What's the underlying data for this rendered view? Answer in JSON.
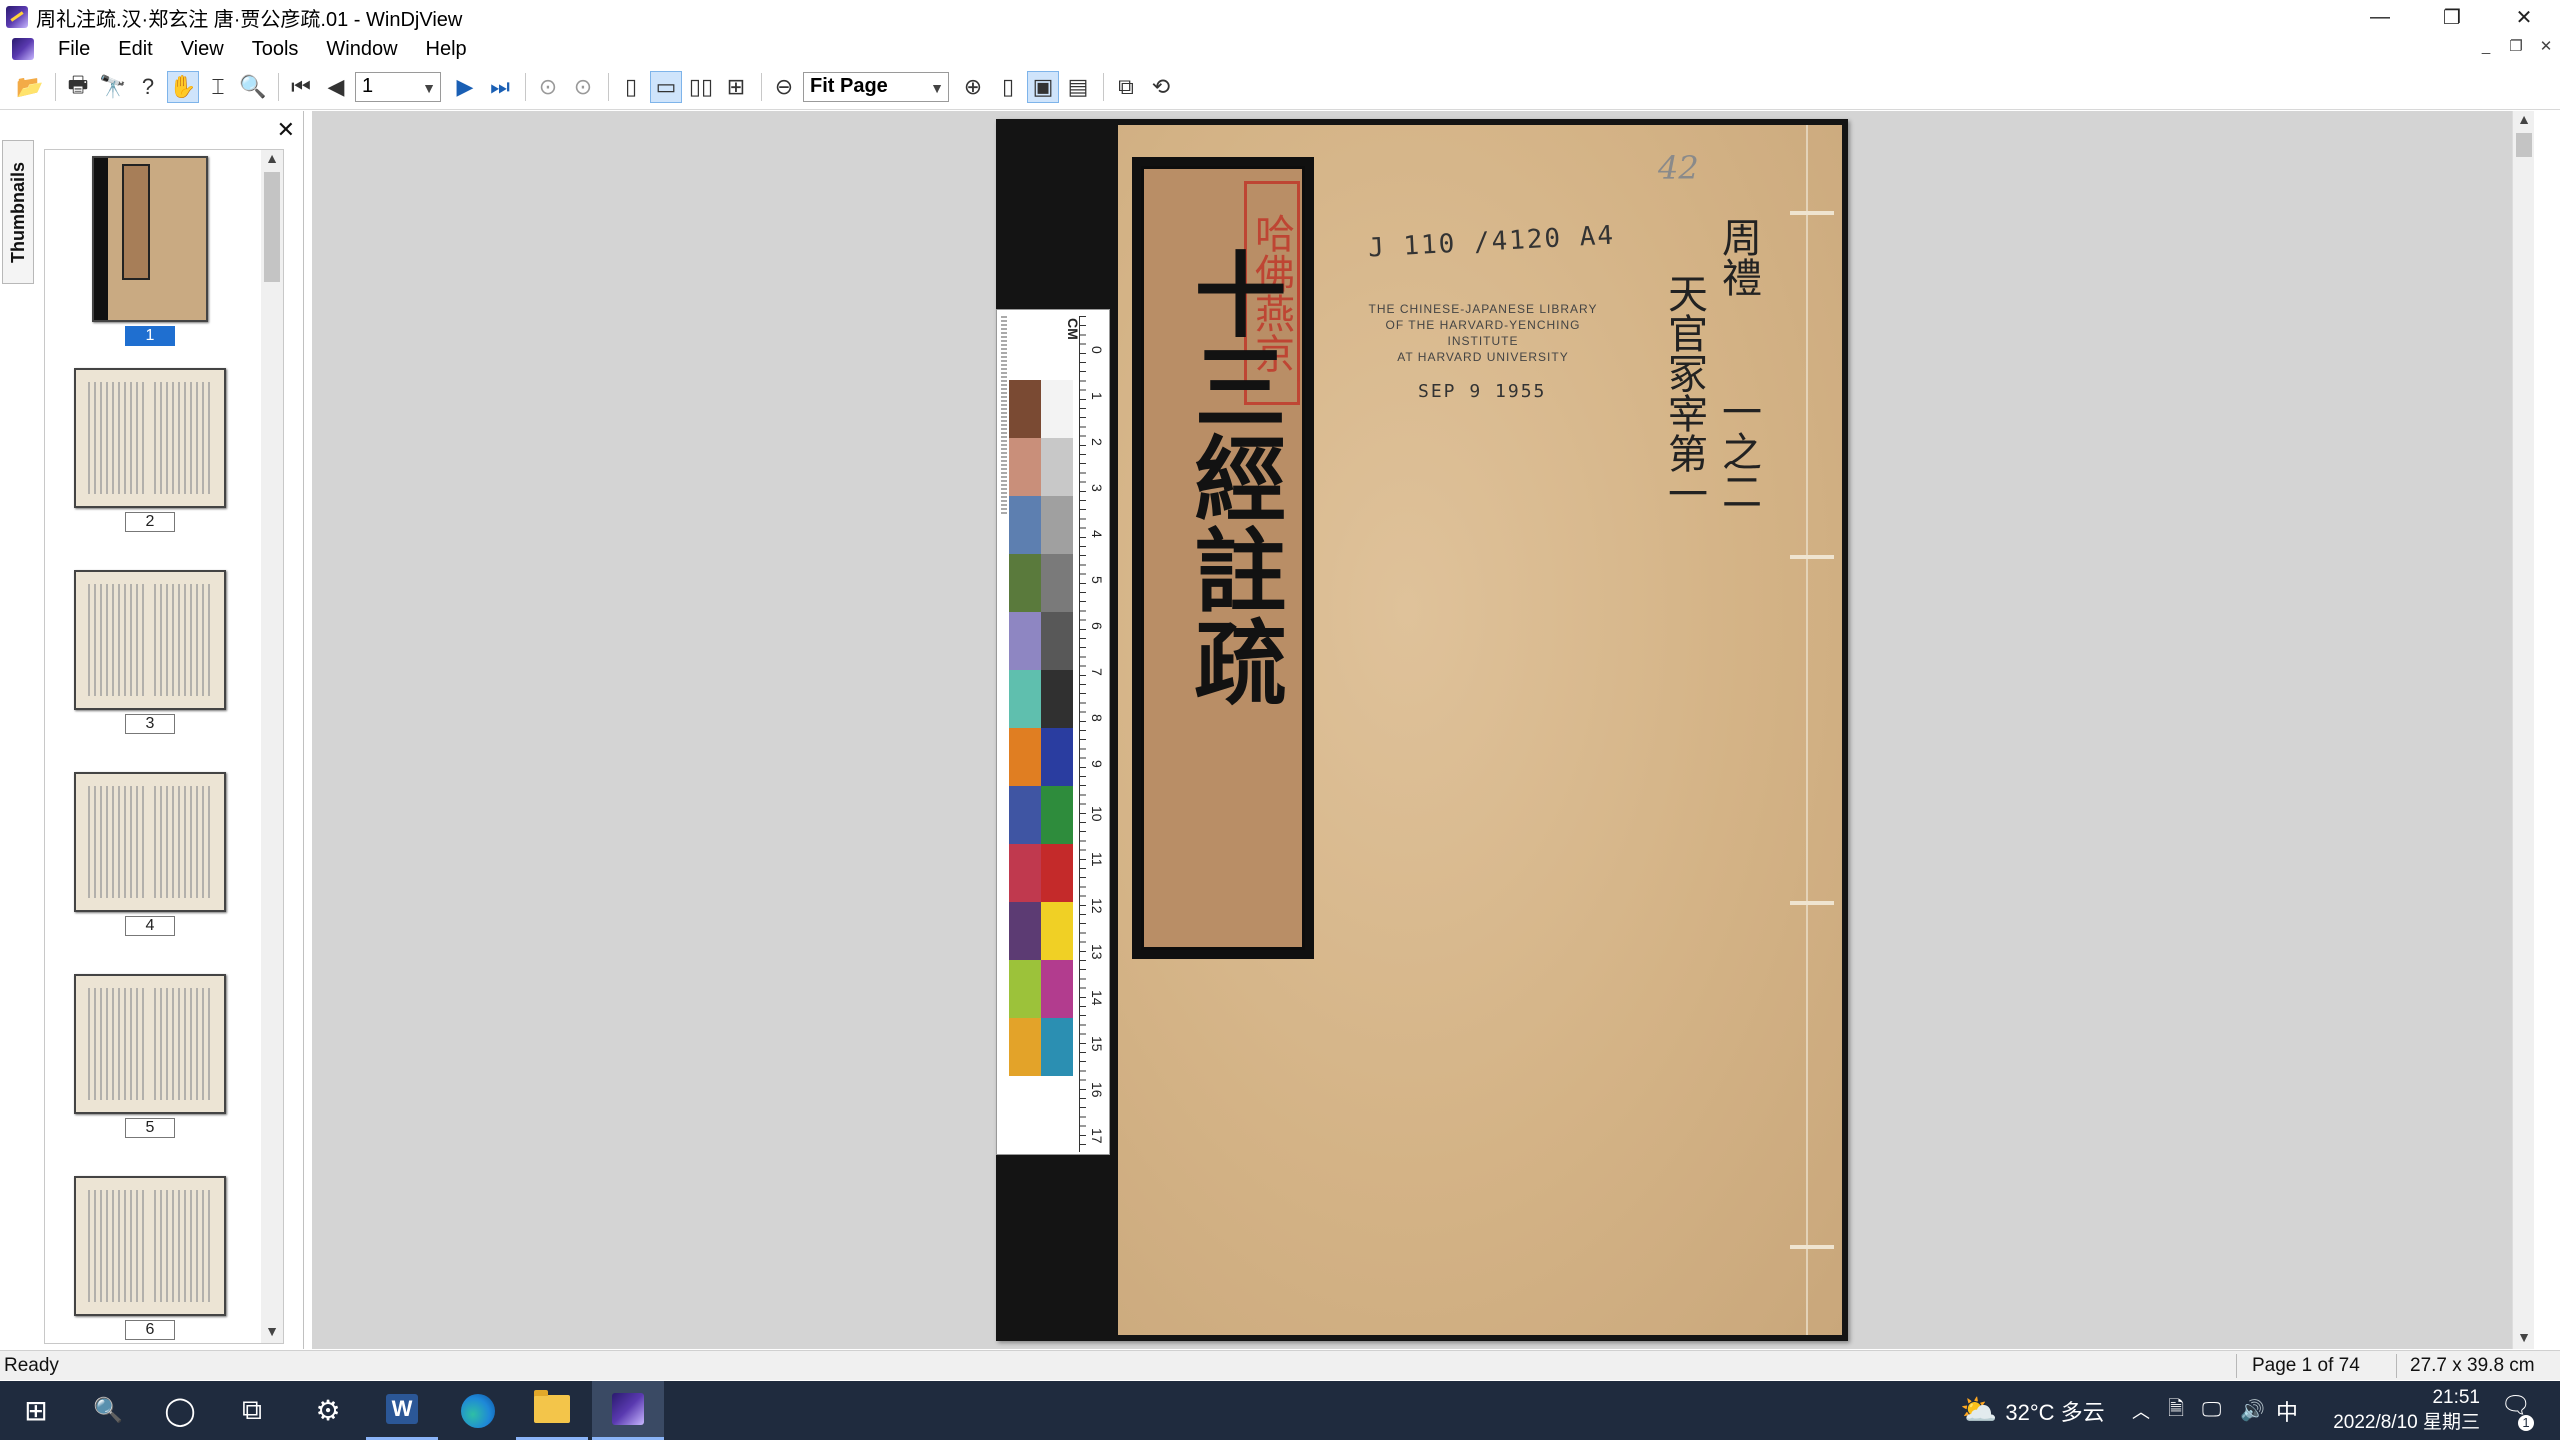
{
  "window": {
    "title": "周礼注疏.汉·郑玄注 唐·贾公彦疏.01 - WinDjView",
    "controls": {
      "minimize": "—",
      "restore": "❐",
      "close": "✕"
    }
  },
  "menu": {
    "items": [
      "File",
      "Edit",
      "View",
      "Tools",
      "Window",
      "Help"
    ],
    "mdi": {
      "minimize": "_",
      "restore": "❐",
      "close": "✕"
    }
  },
  "toolbar": {
    "page_value": "1",
    "zoom_value": "Fit Page",
    "icons": {
      "open": "📂",
      "print": "🖶",
      "find": "🔭",
      "help": "?",
      "hand": "✋",
      "select": "⌶",
      "zoom_tool": "🔍",
      "first": "⏮",
      "prev": "◀",
      "next": "▶",
      "last": "⏭",
      "back": "⊙",
      "forward": "⊙",
      "single": "▯",
      "continuous": "▭",
      "facing": "▯▯",
      "cont_facing": "⊞",
      "zoom_out": "⊖",
      "zoom_in": "⊕",
      "fit": "▯",
      "fit_active": "▣",
      "display": "▤",
      "layout": "⧉",
      "rotate": "⟲"
    }
  },
  "thumbnails": {
    "tab_label": "Thumbnails",
    "close": "✕",
    "selected": "1",
    "pages": [
      "1",
      "2",
      "3",
      "4",
      "5",
      "6"
    ]
  },
  "document": {
    "title_slip": "十三經註疏",
    "seal": "哈佛燕京",
    "call_number": "J 110 /4120 A4",
    "library_stamp": [
      "THE CHINESE-JAPANESE LIBRARY",
      "OF THE HARVARD-YENCHING INSTITUTE",
      "AT HARVARD UNIVERSITY"
    ],
    "date_stamp": "SEP 9 1955",
    "pencil_number": "42",
    "columns": [
      "周禮",
      "一之二",
      "天官冢宰第一"
    ],
    "ruler_ticks": [
      "0",
      "1",
      "2",
      "3",
      "4",
      "5",
      "6",
      "7",
      "8",
      "9",
      "10",
      "11",
      "12",
      "13",
      "14",
      "15",
      "16",
      "17"
    ],
    "ruler_unit": "CM",
    "swatches_left": [
      "#7a4a33",
      "#c98f7a",
      "#5d7fb0",
      "#5a7a3c",
      "#8e86c2",
      "#5fbfae",
      "#e07e22",
      "#3f55a3",
      "#c0394e",
      "#5c3b73",
      "#9cc23a",
      "#e3a329"
    ],
    "swatches_right": [
      "#f3f3f3",
      "#c8c8c8",
      "#a0a0a0",
      "#7a7a7a",
      "#585858",
      "#303030",
      "#2a3da0",
      "#2e8c3c",
      "#c42a2a",
      "#f0d025",
      "#b23c8e",
      "#2b8fb2"
    ]
  },
  "status": {
    "left": "Ready",
    "page": "Page 1 of 74",
    "size": "27.7 x 39.8 cm"
  },
  "taskbar": {
    "start": "⊞",
    "search": "🔍",
    "cortana": "◯",
    "taskview": "⧉",
    "settings": "⚙",
    "word": "W",
    "weather_icon": "⛅",
    "weather": "32°C 多云",
    "tray_arrow": "︿",
    "tray_icons": [
      "🗎",
      "🖵",
      "🔊"
    ],
    "ime": "中",
    "time": "21:51",
    "date": "2022/8/10 星期三",
    "notif": "🗨",
    "notif_count": "1"
  }
}
